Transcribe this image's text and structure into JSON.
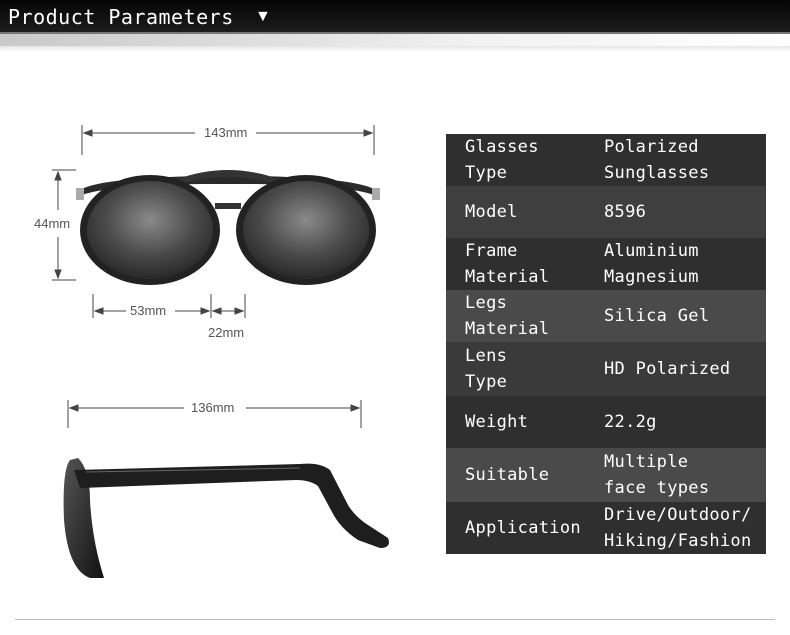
{
  "header": {
    "title": "Product Parameters",
    "arrow": "▼"
  },
  "dimensions": {
    "total_width": "143mm",
    "height": "44mm",
    "lens_width": "53mm",
    "bridge": "22mm",
    "temple_length": "136mm"
  },
  "specs": [
    {
      "label": "Glasses\nType",
      "value": "Polarized\nSunglasses"
    },
    {
      "label": "Model",
      "value": "8596"
    },
    {
      "label": "Frame\nMaterial",
      "value": "Aluminium\nMagnesium"
    },
    {
      "label": "Legs\nMaterial",
      "value": "Silica Gel"
    },
    {
      "label": "Lens\nType",
      "value": "HD Polarized"
    },
    {
      "label": "Weight",
      "value": "22.2g"
    },
    {
      "label": "Suitable",
      "value": "Multiple\nface types"
    },
    {
      "label": "Application",
      "value": "Drive/Outdoor/\nHiking/Fashion"
    }
  ],
  "colors": {
    "row_dark": "#2f2f2f",
    "row_light": "#4a4a4a",
    "header_bg": "#0a0a0a"
  }
}
